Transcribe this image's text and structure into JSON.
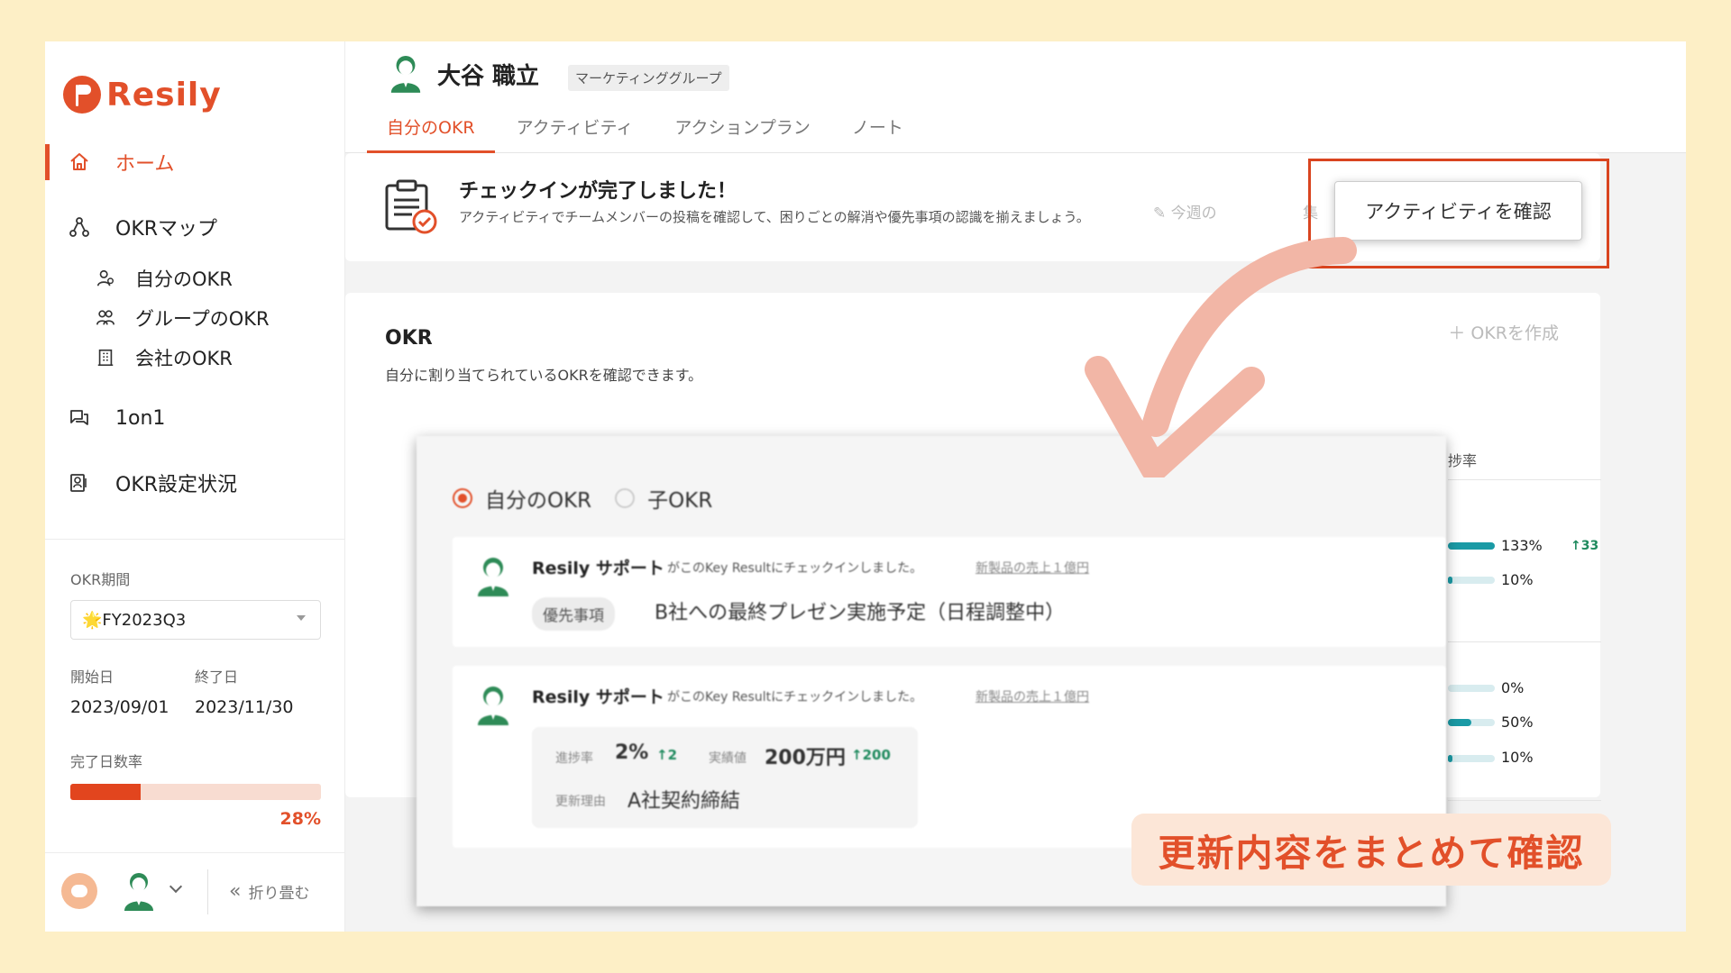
{
  "app": {
    "name": "Resily"
  },
  "sidebar": {
    "items": [
      {
        "label": "ホーム",
        "icon": "home-icon",
        "active": true
      },
      {
        "label": "OKRマップ",
        "icon": "okr-map-icon"
      },
      {
        "label": "1on1",
        "icon": "chat-icon"
      },
      {
        "label": "OKR設定状況",
        "icon": "status-icon"
      }
    ],
    "sub_items": [
      {
        "label": "自分のOKR",
        "icon": "user-icon"
      },
      {
        "label": "グループのOKR",
        "icon": "group-icon"
      },
      {
        "label": "会社のOKR",
        "icon": "building-icon"
      }
    ],
    "period": {
      "label": "OKR期間",
      "selected": "🌟FY2023Q3",
      "start_label": "開始日",
      "start": "2023/09/01",
      "end_label": "終了日",
      "end": "2023/11/30",
      "completion_label": "完了日数率",
      "completion_value": 0.28,
      "completion_text": "28%"
    },
    "collapse_label": "折り畳む"
  },
  "header": {
    "user_name": "大谷 職立",
    "group": "マーケティンググループ",
    "tabs": [
      {
        "label": "自分のOKR",
        "active": true
      },
      {
        "label": "アクティビティ"
      },
      {
        "label": "アクションプラン"
      },
      {
        "label": "ノート"
      }
    ]
  },
  "checkin": {
    "title": "チェックインが完了しました！",
    "description": "アクティビティでチームメンバーの投稿を確認して、困りごとの解消や優先事項の認識を揃えましょう。",
    "week_link": "今週の",
    "week_link_tail": "集",
    "button_label": "アクティビティを確認"
  },
  "okr": {
    "title": "OKR",
    "subtitle": "自分に割り当てられているOKRを確認できます。",
    "create_label": "OKRを作成",
    "progress_header": "捗率",
    "rows": [
      {
        "value": 1.0,
        "pct": "133%",
        "delta": "33"
      },
      {
        "value": 0.1,
        "pct": "10%"
      },
      {
        "value": 0.0,
        "pct": "0%"
      },
      {
        "value": 0.5,
        "pct": "50%"
      },
      {
        "value": 0.1,
        "pct": "10%"
      }
    ]
  },
  "activity_overlay": {
    "radio_options": [
      {
        "label": "自分のOKR",
        "checked": true
      },
      {
        "label": "子OKR",
        "checked": false
      }
    ],
    "items": [
      {
        "user": "Resily サポート",
        "action": "がこのKey Resultにチェックインしました。",
        "target": "新製品の売上１億円",
        "tag": "優先事項",
        "text": "B社への最終プレゼン実施予定（日程調整中）"
      },
      {
        "user": "Resily サポート",
        "action": "がこのKey Resultにチェックインしました。",
        "target": "新製品の売上１億円",
        "progress_label": "進捗率",
        "progress_value": "2%",
        "progress_delta": "2",
        "actual_label": "実績値",
        "actual_value": "200万円",
        "actual_delta": "200",
        "reason_label": "更新理由",
        "reason": "A社契約締結"
      }
    ]
  },
  "caption": "更新内容をまとめて確認",
  "colors": {
    "accent": "#e2502a",
    "background": "#fdefc6",
    "positive": "#1f8a5e",
    "teal": "#1a9aa5"
  }
}
